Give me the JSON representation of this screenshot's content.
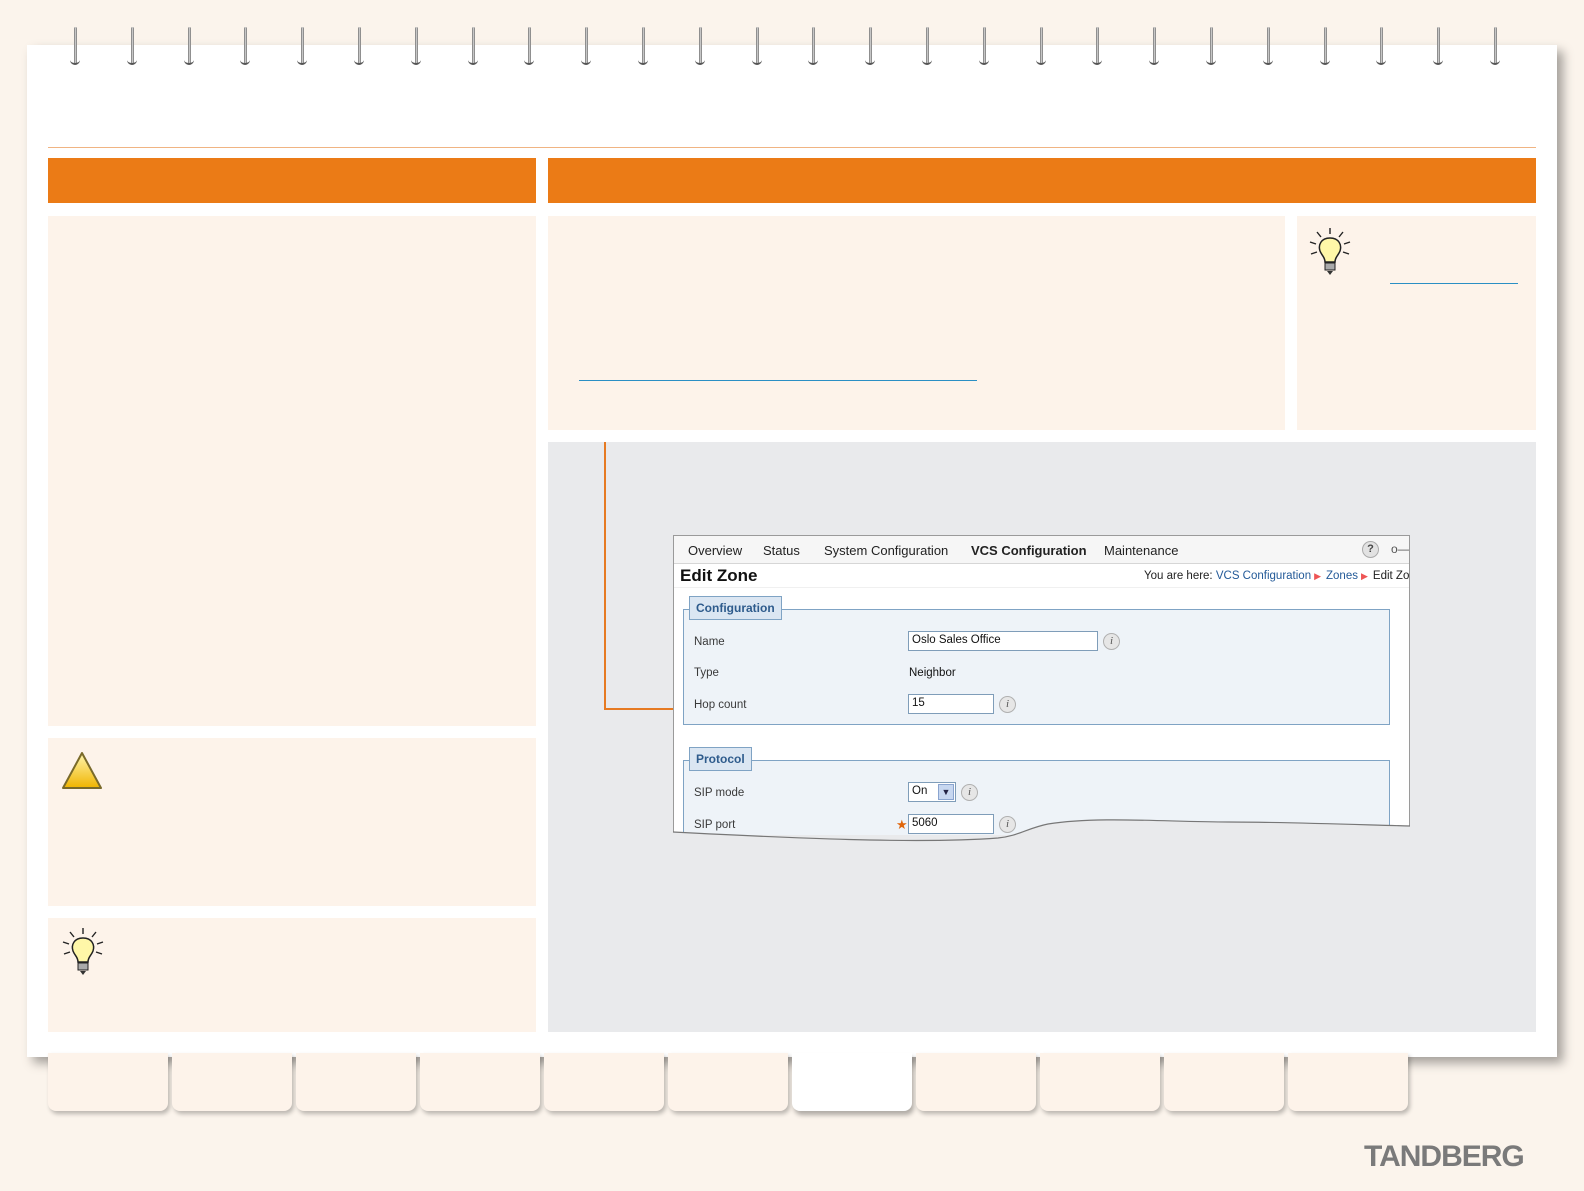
{
  "window": {
    "nav": {
      "items": [
        "Overview",
        "Status",
        "System Configuration",
        "VCS Configuration",
        "Maintenance"
      ],
      "active": "VCS Configuration"
    },
    "page_title": "Edit Zone",
    "breadcrumb": {
      "prefix": "You are here:",
      "items": [
        "VCS Configuration",
        "Zones",
        "Edit Zone"
      ],
      "visible_last": "Edit Zo"
    },
    "configuration": {
      "legend": "Configuration",
      "name_label": "Name",
      "name_value": "Oslo Sales Office",
      "type_label": "Type",
      "type_value": "Neighbor",
      "hop_label": "Hop count",
      "hop_value": "15"
    },
    "protocol": {
      "legend": "Protocol",
      "sip_mode_label": "SIP mode",
      "sip_mode_value": "On",
      "sip_port_label": "SIP port",
      "sip_port_value": "5060"
    }
  },
  "brand": "TANDBERG",
  "icons": {
    "help": "help-icon",
    "logout": "key-icon",
    "info": "info-icon",
    "tip": "lightbulb-icon",
    "warning": "warning-triangle-icon"
  },
  "colors": {
    "accent": "#eb7b16",
    "panel": "#fdf3ea",
    "link": "#235a98"
  }
}
